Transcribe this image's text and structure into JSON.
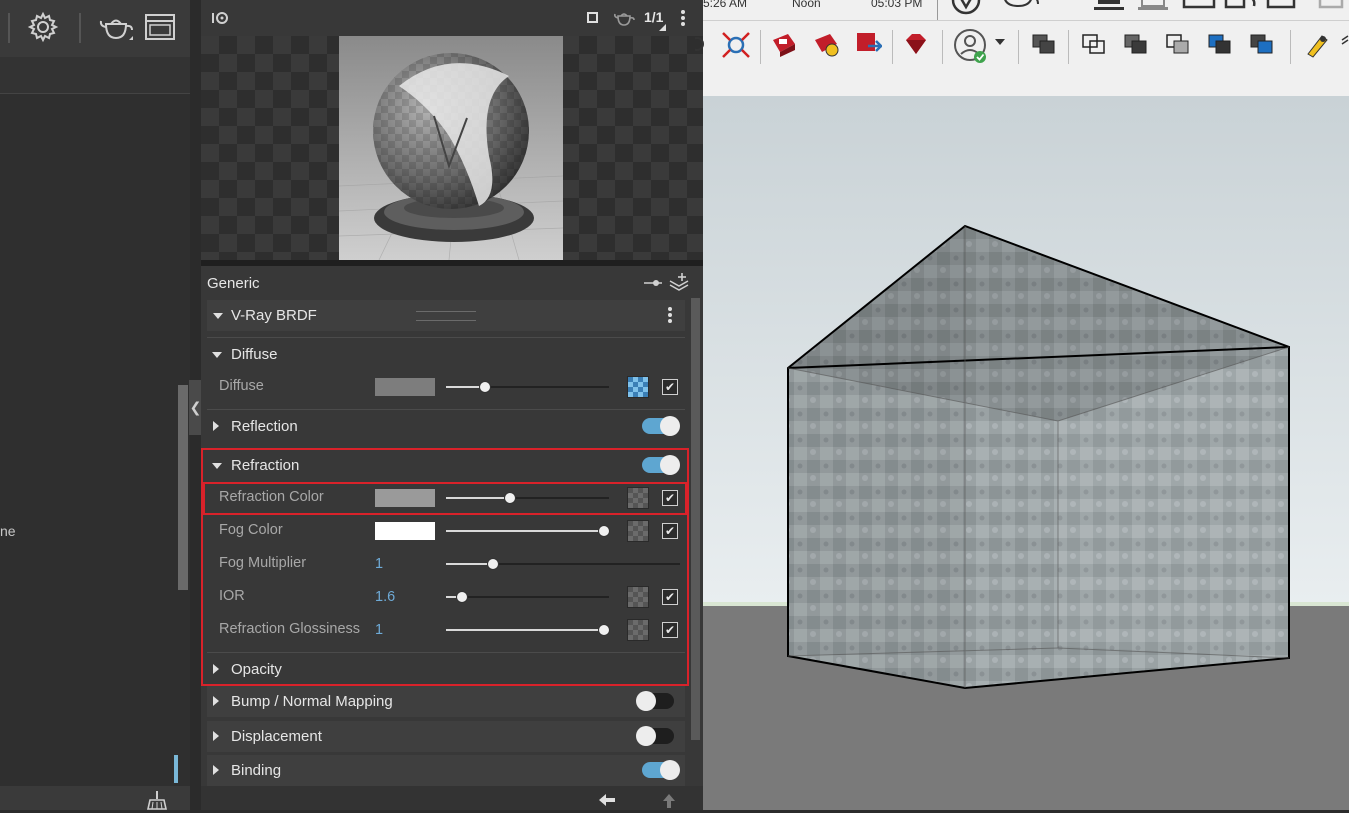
{
  "left": {
    "partial_text": "ne"
  },
  "preview": {
    "page_indicator": "1/1"
  },
  "editor": {
    "header": "Generic",
    "brdf_title": "V-Ray BRDF",
    "diffuse_section": "Diffuse",
    "diffuse_param": {
      "label": "Diffuse",
      "slider": 0.24
    },
    "reflection_section": "Reflection",
    "refraction_section": "Refraction",
    "params": [
      {
        "label": "Refraction Color",
        "slider": 0.39
      },
      {
        "label": "Fog Color",
        "slider": 0.97
      },
      {
        "label": "Fog Multiplier",
        "value": "1",
        "slider": 0.2
      },
      {
        "label": "IOR",
        "value": "1.6",
        "slider": 0.1
      },
      {
        "label": "Refraction Glossiness",
        "value": "1",
        "slider": 0.97
      }
    ],
    "opacity_section": "Opacity",
    "bump_section": "Bump / Normal Mapping",
    "displacement_section": "Displacement",
    "binding_section": "Binding"
  },
  "viewport_toolbar": {
    "time_labels": [
      "5:26 AM",
      "Noon",
      "05:03 PM"
    ]
  },
  "colors": {
    "accent": "#5ea6d1",
    "highlight": "#d9222a",
    "diffuse_swatch": "#7d7d7d",
    "refraction_swatch": "#9a9a9a",
    "fog_swatch": "#ffffff"
  }
}
